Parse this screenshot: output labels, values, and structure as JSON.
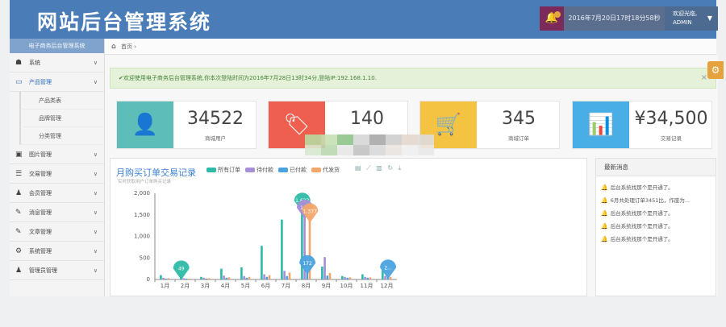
{
  "header": {
    "title": "网站后台管理系统",
    "datetime": "2016年7月20日17时18分58秒",
    "user_greeting": "欢迎光临,",
    "username": "ADMIN"
  },
  "sidebar": {
    "title": "电子商务后台管理系统",
    "items": [
      {
        "label": "系统",
        "icon": "dashboard-icon",
        "glyph": "☗"
      },
      {
        "label": "产品管理",
        "icon": "monitor-icon",
        "glyph": "▭",
        "active": true
      },
      {
        "label": "图片管理",
        "icon": "picture-icon",
        "glyph": "▣"
      },
      {
        "label": "交易管理",
        "icon": "list-icon",
        "glyph": "☰"
      },
      {
        "label": "会员管理",
        "icon": "user-icon",
        "glyph": "♟"
      },
      {
        "label": "消息管理",
        "icon": "edit-icon",
        "glyph": "✎"
      },
      {
        "label": "文章管理",
        "icon": "edit-icon",
        "glyph": "✎"
      },
      {
        "label": "系统管理",
        "icon": "cogs-icon",
        "glyph": "⚙"
      },
      {
        "label": "管理员管理",
        "icon": "group-icon",
        "glyph": "♟"
      }
    ],
    "subitems": [
      "产品类表",
      "品牌管理",
      "分类管理"
    ]
  },
  "breadcrumb": {
    "home": "首页",
    "sep": "›"
  },
  "alert": {
    "text": "✔欢迎使用电子商务后台管理系统,你本次登陆时间为2016年7月28日13时34分,登陆IP:192.168.1.10.",
    "close": "×"
  },
  "stats": [
    {
      "value": "34522",
      "label": "商城用户",
      "color": "#5cbdb9",
      "icon": "user-icon",
      "glyph": "👤"
    },
    {
      "value": "140",
      "label": "",
      "color": "#ef5f4f",
      "icon": "tags-icon",
      "glyph": "🏷"
    },
    {
      "value": "345",
      "label": "商城订单",
      "color": "#f4c341",
      "icon": "cart-icon",
      "glyph": "🛒"
    },
    {
      "value": "¥34,500",
      "label": "交易记录",
      "color": "#4aaee6",
      "icon": "bar-chart-icon",
      "glyph": "📊"
    }
  ],
  "news": {
    "title": "最新消息",
    "items": [
      "后台系统找那个是开通了。",
      "6月共处理订单3451比，作废为...",
      "后台系统找那个是开通了。",
      "后台系统找那个是开通了。",
      "后台系统找那个是开通了。"
    ]
  },
  "colors": {
    "header": "#4a7db8",
    "accent": "#3a7fd5",
    "series": [
      "#2ebaa8",
      "#a78fd6",
      "#4aa3df",
      "#f3a66b"
    ]
  },
  "chart_data": {
    "type": "bar",
    "title": "月购买订单交易记录",
    "subtitle": "实时获取用户订单购买记录",
    "categories": [
      "1月",
      "2月",
      "3月",
      "4月",
      "5月",
      "6月",
      "7月",
      "8月",
      "9月",
      "10月",
      "11月",
      "12月"
    ],
    "series": [
      {
        "name": "所有订单",
        "values": [
          100,
          49,
          60,
          250,
          280,
          780,
          1390,
          1622,
          300,
          80,
          120,
          220
        ]
      },
      {
        "name": "待付款",
        "values": [
          40,
          30,
          40,
          90,
          80,
          120,
          200,
          1460,
          520,
          60,
          60,
          80
        ]
      },
      {
        "name": "已付款",
        "values": [
          20,
          20,
          20,
          40,
          40,
          60,
          80,
          172,
          90,
          40,
          40,
          70
        ]
      },
      {
        "name": "代发货",
        "values": [
          30,
          20,
          30,
          50,
          60,
          100,
          160,
          1377,
          150,
          50,
          50,
          60
        ]
      }
    ],
    "ylim": [
      0,
      2000
    ],
    "yticks": [
      0,
      500,
      1000,
      1500,
      2000
    ],
    "ytick_labels": [
      "0",
      "500",
      "1,000",
      "1,500",
      "2,000"
    ],
    "markers": [
      {
        "series": 0,
        "index": 1,
        "label": "49"
      },
      {
        "series": 0,
        "index": 7,
        "label": "1,622"
      },
      {
        "series": 1,
        "index": 7,
        "label": "1,..."
      },
      {
        "series": 3,
        "index": 7,
        "label": "1,377"
      },
      {
        "series": 2,
        "index": 7,
        "label": "172"
      },
      {
        "series": 2,
        "index": 11,
        "label": "2..."
      }
    ],
    "legend_position": "top",
    "grid": false
  }
}
